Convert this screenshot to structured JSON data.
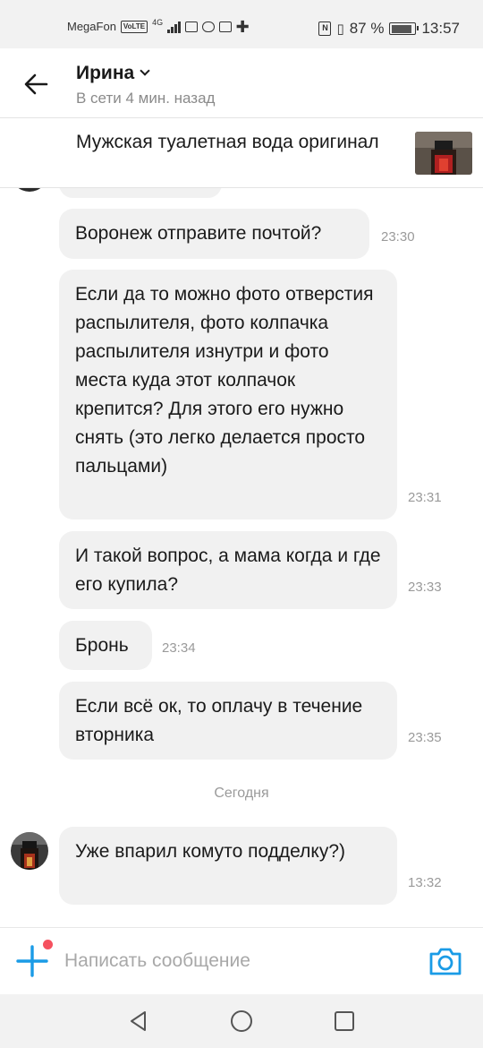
{
  "status_bar": {
    "carrier": "MegaFon",
    "volte": "VoLTE",
    "network": "4G",
    "battery": "87 %",
    "battery_level": 0.87,
    "time": "13:57"
  },
  "header": {
    "contact_name": "Ирина",
    "status": "В сети 4 мин. назад"
  },
  "listing": {
    "title": "Мужская туалетная вода оригинал"
  },
  "messages": [
    {
      "text": "Воронеж отправите почтой?",
      "time": "23:30"
    },
    {
      "text": "Если да то можно фото отверстия распылителя, фото колпачка распылителя изнутри и фото места куда этот колпачок крепится? Для этого его нужно снять (это легко делается просто пальцами)",
      "time": "23:31"
    },
    {
      "text": "И такой вопрос, а мама когда и где его купила?",
      "time": "23:33"
    },
    {
      "text": "Бронь",
      "time": "23:34"
    },
    {
      "text": "Если всё ок, то оплачу в течение вторника",
      "time": "23:35"
    },
    {
      "text": "Уже впарил комуто подделку?)",
      "time": "13:32"
    }
  ],
  "day_separator": "Сегодня",
  "composer": {
    "placeholder": "Написать сообщение",
    "accent_color": "#1a9be6",
    "dot_color": "#f5515f"
  },
  "icons": {
    "back": "arrow-left-icon",
    "plus": "plus-icon",
    "camera": "camera-icon",
    "nav_back": "triangle-back-icon",
    "nav_home": "circle-home-icon",
    "nav_recent": "square-recent-icon"
  }
}
